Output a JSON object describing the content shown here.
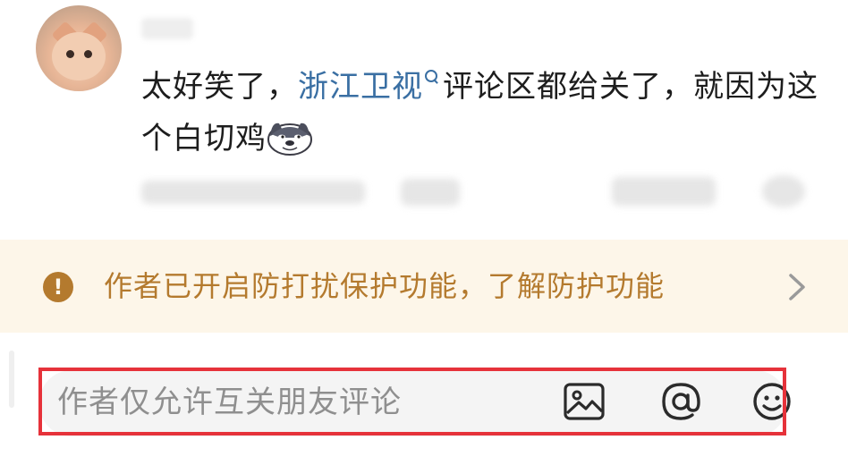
{
  "comment": {
    "username": "",
    "text_before": "太好笑了，",
    "topic_link": "浙江卫视",
    "text_after": "评论区都给关了，就因为这个白切鸡",
    "avatar_icon": "cat-avatar",
    "emoji_icon": "doge-emoji",
    "topic_icon": "search-icon"
  },
  "notice": {
    "text": "作者已开启防打扰保护功能，了解防护功能",
    "icon": "exclamation-icon",
    "arrow": "chevron-right-icon",
    "color": "#b47a2e",
    "background": "#fdf6e9"
  },
  "compose": {
    "placeholder": "作者仅允许互关朋友评论",
    "icons": [
      "image-icon",
      "at-icon",
      "emoji-face-icon"
    ],
    "highlight_color": "#e6323a"
  },
  "colors": {
    "topic_link": "#3a6fa3",
    "text": "#1d1d1d",
    "placeholder": "#8f8f8f"
  }
}
